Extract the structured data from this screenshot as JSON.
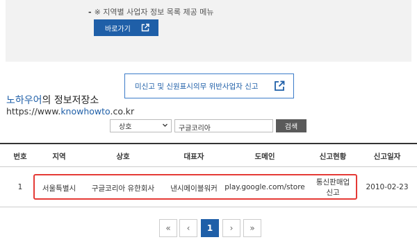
{
  "notice": {
    "dash": "-",
    "text": "※ 지역별 사업자 정보 목록 제공 메뉴"
  },
  "go_button": {
    "label": "바로가기",
    "icon": "external-link-icon"
  },
  "report_button": {
    "label": "미신고 및 신원표시의무 위반사업자 신고",
    "icon": "external-link-icon"
  },
  "watermark": {
    "line1_brand": "노하우어",
    "line1_rest": "의 정보저장소",
    "line2_pre": "https://www.",
    "line2_brand": "knowhowto",
    "line2_post": ".co.kr"
  },
  "search": {
    "field_selected": "상호",
    "query": "구글코리아",
    "button": "검색"
  },
  "table": {
    "headers": [
      "번호",
      "지역",
      "상호",
      "대표자",
      "도메인",
      "신고현황",
      "신고일자"
    ],
    "rows": [
      {
        "no": "1",
        "region": "서울특별시",
        "company": "구글코리아 유한회사",
        "representative": "낸시메이블워커",
        "domain": "play.google.com/store",
        "status_line1": "통신판매업",
        "status_line2": "신고",
        "date": "2010-02-23"
      }
    ]
  },
  "pagination": {
    "first": "«",
    "prev": "‹",
    "current": "1",
    "next": "›",
    "last": "»"
  },
  "colors": {
    "primary": "#1f5fa8",
    "highlight": "#e53935",
    "search_button": "#5a5a5a"
  }
}
